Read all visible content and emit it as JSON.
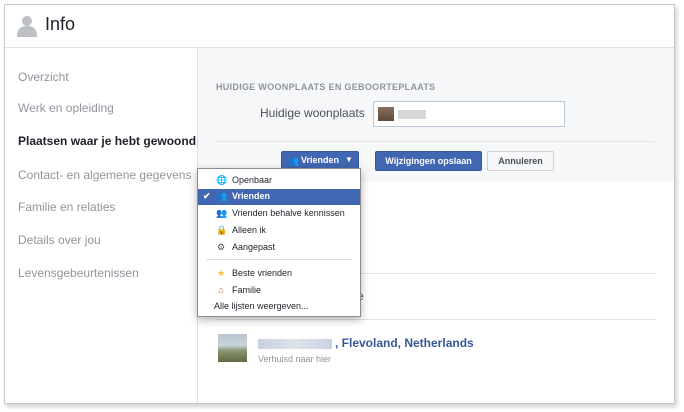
{
  "header": {
    "title": "Info",
    "icon": "person-icon"
  },
  "sidebar": {
    "items": [
      {
        "label": "Overzicht"
      },
      {
        "label": "Werk en opleiding"
      },
      {
        "label": "Plaatsen waar je hebt gewoond"
      },
      {
        "label": "Contact- en algemene gegevens"
      },
      {
        "label": "Familie en relaties"
      },
      {
        "label": "Details over jou"
      },
      {
        "label": "Levensgebeurtenissen"
      }
    ],
    "active_index": 2
  },
  "section": {
    "title": "HUIDIGE WOONPLAATS EN GEBOORTEPLAATS",
    "current_city_label": "Huidige woonplaats"
  },
  "buttons": {
    "privacy": "Vrienden",
    "save": "Wijzigingen opslaan",
    "cancel": "Annuleren"
  },
  "privacy_menu": {
    "items": [
      {
        "label": "Openbaar",
        "icon": "globe-icon"
      },
      {
        "label": "Vrienden",
        "icon": "friends-icon",
        "selected": true
      },
      {
        "label": "Vrienden behalve kennissen",
        "icon": "friends-minus-icon"
      },
      {
        "label": "Alleen ik",
        "icon": "lock-icon"
      },
      {
        "label": "Aangepast",
        "icon": "gear-icon"
      },
      {
        "label": "Beste vrienden",
        "icon": "star-icon"
      },
      {
        "label": "Familie",
        "icon": "house-icon"
      },
      {
        "label": "Alle lijsten weergeven..."
      }
    ]
  },
  "link_fragment": "e",
  "place": {
    "name": ", Flevoland, Netherlands",
    "subtitle": "Verhuisd naar hier"
  },
  "colors": {
    "accent": "#4267b2",
    "link": "#365899",
    "muted": "#90949c",
    "background": "#f6f7f9"
  }
}
